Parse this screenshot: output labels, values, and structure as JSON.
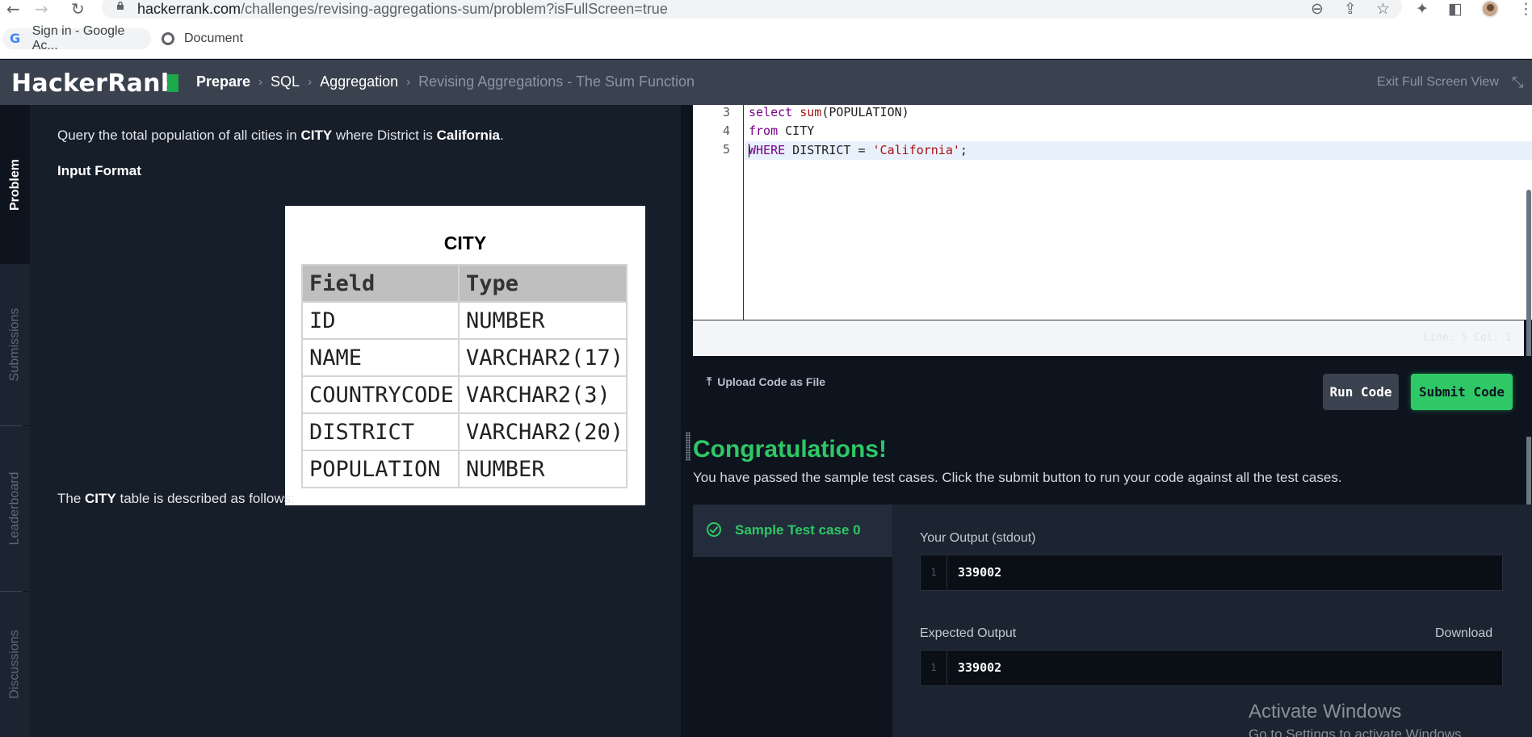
{
  "browser": {
    "url_host": "hackerrank.com",
    "url_path": "/challenges/revising-aggregations-sum/problem?isFullScreen=true",
    "bookmarks": [
      {
        "label": "Sign in - Google Ac...",
        "icon": "google-g-icon"
      },
      {
        "label": "Document",
        "icon": "globe-icon"
      }
    ]
  },
  "header": {
    "logo": "HackerRank",
    "breadcrumbs": [
      "Prepare",
      "SQL",
      "Aggregation",
      "Revising Aggregations - The Sum Function"
    ],
    "exit_fullscreen": "Exit Full Screen View"
  },
  "sidebar": {
    "tabs": [
      "Problem",
      "Submissions",
      "Leaderboard",
      "Discussions"
    ]
  },
  "problem": {
    "statement_pre": "Query the total population of all cities in ",
    "statement_city": "CITY",
    "statement_mid": " where District is ",
    "statement_district": "California",
    "statement_end": ".",
    "input_format": "Input Format",
    "table_desc_pre": "The ",
    "table_desc_city": "CITY",
    "table_desc_post": " table is described as follows:",
    "table": {
      "title": "CITY",
      "headers": [
        "Field",
        "Type"
      ],
      "rows": [
        [
          "ID",
          "NUMBER"
        ],
        [
          "NAME",
          "VARCHAR2(17)"
        ],
        [
          "COUNTRYCODE",
          "VARCHAR2(3)"
        ],
        [
          "DISTRICT",
          "VARCHAR2(20)"
        ],
        [
          "POPULATION",
          "NUMBER"
        ]
      ]
    }
  },
  "editor": {
    "lines": [
      {
        "num": "3",
        "kw": "select",
        "fn": "sum",
        "rest": "(POPULATION)"
      },
      {
        "num": "4",
        "kw": "from",
        "rest": " CITY"
      },
      {
        "num": "5",
        "kw": "WHERE",
        "rest": " DISTRICT = ",
        "str": "'California'",
        "end": ";"
      }
    ],
    "status": "Line: 5 Col: 1"
  },
  "actions": {
    "upload": "Upload Code as File",
    "run": "Run Code",
    "submit": "Submit Code"
  },
  "results": {
    "title": "Congratulations!",
    "message": "You have passed the sample test cases. Click the submit button to run your code against all the test cases.",
    "testcase": "Sample Test case 0",
    "your_output_label": "Your Output (stdout)",
    "your_output_line": "1",
    "your_output": "339002",
    "expected_label": "Expected Output",
    "expected_line": "1",
    "expected_output": "339002",
    "download": "Download"
  },
  "watermark": {
    "title": "Activate Windows",
    "subtitle": "Go to Settings to activate Windows."
  },
  "colors": {
    "brand_green": "#1ba94c",
    "success": "#2ec866",
    "header_bg": "#39424e",
    "page_bg": "#0e141e"
  }
}
